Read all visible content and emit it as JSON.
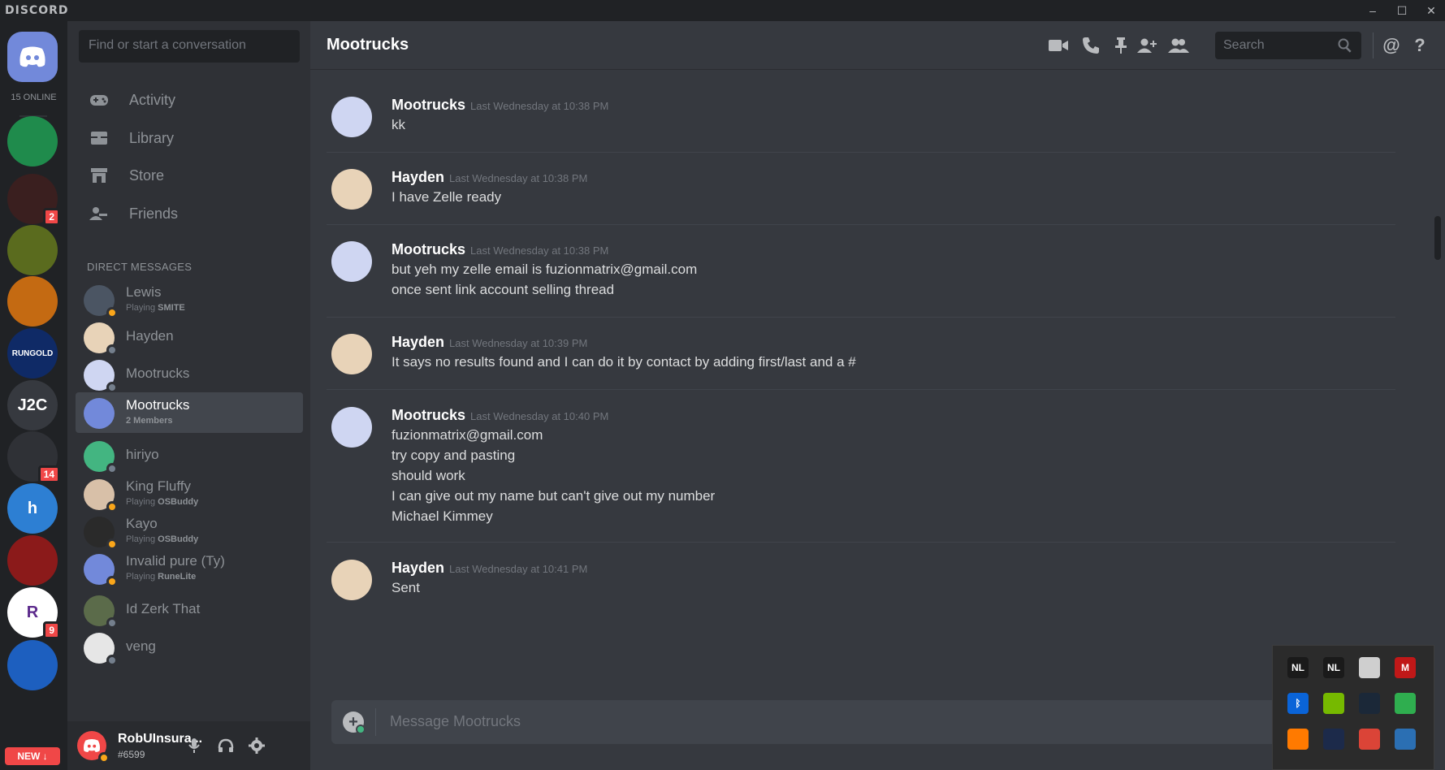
{
  "app": {
    "brand": "DISCORD"
  },
  "window_controls": [
    "–",
    "☐",
    "✕"
  ],
  "rail": {
    "online_label": "15 ONLINE",
    "servers": [
      {
        "name": "server-next-level",
        "label": "",
        "color": "#1f8b4c",
        "badge": ""
      },
      {
        "name": "server-resurgence",
        "label": "",
        "color": "#3a1f1f",
        "badge": "2"
      },
      {
        "name": "server-runescape",
        "label": "",
        "color": "#5a6b1e",
        "badge": ""
      },
      {
        "name": "server-rune-treasure",
        "label": "",
        "color": "#c46a12",
        "badge": ""
      },
      {
        "name": "server-rungold",
        "label": "RUNGOLD",
        "color": "#0f2a66",
        "badge": ""
      },
      {
        "name": "server-j2c",
        "label": "J2C",
        "color": "#36393f",
        "badge": ""
      },
      {
        "name": "server-shark",
        "label": "",
        "color": "#2f3136",
        "badge": "14"
      },
      {
        "name": "server-h",
        "label": "h",
        "color": "#2d7fd3",
        "badge": ""
      },
      {
        "name": "server-red-wheel",
        "label": "",
        "color": "#8b1a1a",
        "badge": ""
      },
      {
        "name": "server-r",
        "label": "R",
        "color": "#ffffff",
        "badge": "9"
      },
      {
        "name": "server-paw",
        "label": "",
        "color": "#1d5fbf",
        "badge": ""
      }
    ],
    "new_label": "NEW ↓"
  },
  "dm_sidebar": {
    "search_placeholder": "Find or start a conversation",
    "nav": [
      {
        "label": "Activity"
      },
      {
        "label": "Library"
      },
      {
        "label": "Store"
      },
      {
        "label": "Friends"
      }
    ],
    "dm_header": "DIRECT MESSAGES",
    "dms": [
      {
        "name": "Lewis",
        "sub_prefix": "Playing ",
        "sub_game": "SMITE",
        "status": "idle",
        "color": "#4b5563",
        "active": false
      },
      {
        "name": "Hayden",
        "sub_prefix": "",
        "sub_game": "",
        "status": "off",
        "color": "#e8d3b8",
        "active": false
      },
      {
        "name": "Mootrucks",
        "sub_prefix": "",
        "sub_game": "",
        "status": "off",
        "color": "#cfd6f2",
        "active": false
      },
      {
        "name": "Mootrucks",
        "sub_prefix": "",
        "sub_game": "2 Members",
        "status": "",
        "color": "#7289da",
        "active": true
      },
      {
        "name": "hiriyo",
        "sub_prefix": "",
        "sub_game": "",
        "status": "off",
        "color": "#43b581",
        "active": false
      },
      {
        "name": "King Fluffy",
        "sub_prefix": "Playing ",
        "sub_game": "OSBuddy",
        "status": "idle",
        "color": "#d8c0a8",
        "active": false
      },
      {
        "name": "Kayo",
        "sub_prefix": "Playing ",
        "sub_game": "OSBuddy",
        "status": "idle",
        "color": "#2a2a2a",
        "active": false
      },
      {
        "name": "Invalid pure (Ty)",
        "sub_prefix": "Playing ",
        "sub_game": "RuneLite",
        "status": "idle",
        "color": "#7289da",
        "active": false
      },
      {
        "name": "Id Zerk That",
        "sub_prefix": "",
        "sub_game": "",
        "status": "off",
        "color": "#5b6b4a",
        "active": false
      },
      {
        "name": "veng",
        "sub_prefix": "",
        "sub_game": "",
        "status": "off",
        "color": "#e6e6e6",
        "active": false
      }
    ],
    "user": {
      "name": "RobUInsura...",
      "tag": "#6599"
    }
  },
  "channel": {
    "title": "Mootrucks",
    "search_placeholder": "Search",
    "compose_placeholder": "Message Mootrucks"
  },
  "messages": [
    {
      "author": "Mootrucks",
      "time": "Last Wednesday at 10:38 PM",
      "avatar_color": "#cfd6f2",
      "lines": [
        "kk"
      ]
    },
    {
      "author": "Hayden",
      "time": "Last Wednesday at 10:38 PM",
      "avatar_color": "#e8d3b8",
      "lines": [
        "I have Zelle ready"
      ]
    },
    {
      "author": "Mootrucks",
      "time": "Last Wednesday at 10:38 PM",
      "avatar_color": "#cfd6f2",
      "lines": [
        "but yeh my zelle email is fuzionmatrix@gmail.com",
        "once sent link account selling thread"
      ]
    },
    {
      "author": "Hayden",
      "time": "Last Wednesday at 10:39 PM",
      "avatar_color": "#e8d3b8",
      "lines": [
        "It says no results found and I can do it by contact by adding first/last and a #"
      ]
    },
    {
      "author": "Mootrucks",
      "time": "Last Wednesday at 10:40 PM",
      "avatar_color": "#cfd6f2",
      "lines": [
        "fuzionmatrix@gmail.com",
        "try copy and pasting",
        "should work",
        "I can give out my name but can't give out my number",
        "Michael Kimmey"
      ]
    },
    {
      "author": "Hayden",
      "time": "Last Wednesday at 10:41 PM",
      "avatar_color": "#e8d3b8",
      "lines": [
        "Sent"
      ]
    }
  ],
  "tray": {
    "icons": [
      {
        "name": "nl-tray-icon-1",
        "label": "NL",
        "color": "#1a1a1a"
      },
      {
        "name": "nl-tray-icon-2",
        "label": "NL",
        "color": "#1a1a1a"
      },
      {
        "name": "sync-tray-icon",
        "label": "",
        "color": "#cfcfcf"
      },
      {
        "name": "mcafee-tray-icon",
        "label": "M",
        "color": "#c01818"
      },
      {
        "name": "bluetooth-tray-icon",
        "label": "ᛒ",
        "color": "#0a64d8"
      },
      {
        "name": "nvidia-tray-icon",
        "label": "",
        "color": "#76b900"
      },
      {
        "name": "steam-tray-icon",
        "label": "",
        "color": "#1b2838"
      },
      {
        "name": "greenshot-tray-icon",
        "label": "",
        "color": "#2fae4f"
      },
      {
        "name": "avast-tray-icon",
        "label": "",
        "color": "#ff7a00"
      },
      {
        "name": "dots-tray-icon",
        "label": "",
        "color": "#1c2a4a"
      },
      {
        "name": "chrome-tray-icon",
        "label": "",
        "color": "#db4437"
      },
      {
        "name": "network-tray-icon",
        "label": "",
        "color": "#2b6fb3"
      }
    ]
  }
}
